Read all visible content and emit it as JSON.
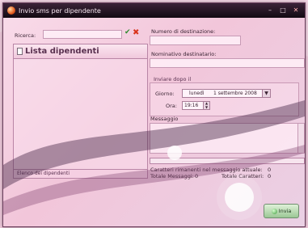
{
  "window": {
    "title": "Invio sms per dipendente"
  },
  "search": {
    "label": "Ricerca:",
    "value": ""
  },
  "employee_list": {
    "title": "Lista dipendenti",
    "footer": "Elenco dei dipendenti"
  },
  "destination": {
    "number_label": "Numero di destinazione:",
    "number_value": "",
    "name_label": "Nominativo destinatario:",
    "name_value": ""
  },
  "schedule": {
    "group_label": "Inviare dopo il",
    "day_label": "Giorno:",
    "weekday": "lunedì",
    "date": "1 settembre 2008",
    "time_label": "Ora:",
    "time": "19:16"
  },
  "message": {
    "label": "Messaggio",
    "value": ""
  },
  "stats": {
    "remaining_label": "Caratteri rimanenti nel messaggio attuale:",
    "remaining_value": "0",
    "total_messages_label": "Totale Messaggi:",
    "total_messages_value": "0",
    "total_chars_label": "Totale Caratteri:",
    "total_chars_value": "0"
  },
  "send_button": {
    "label": "Invia"
  },
  "colors": {
    "accent": "#5aa644",
    "titlebar": "#120a12",
    "background": "#f2c6da"
  }
}
